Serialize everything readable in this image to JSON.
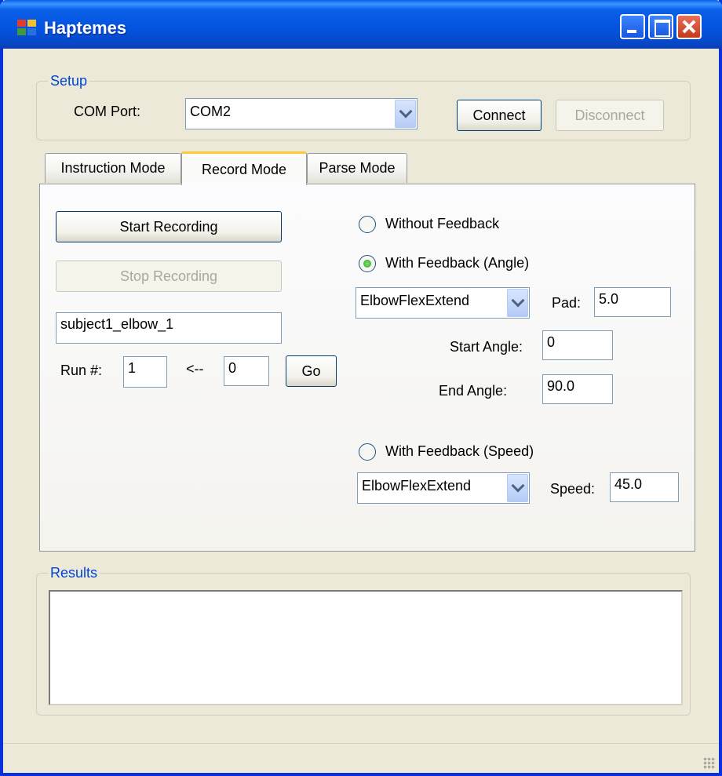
{
  "window": {
    "title": "Haptemes",
    "app_icon": "form-icon",
    "controls": {
      "minimize": "minimize-icon",
      "maximize": "maximize-icon",
      "close": "close-icon"
    }
  },
  "setup": {
    "legend": "Setup",
    "com_port_label": "COM Port:",
    "com_port_value": "COM2",
    "connect_label": "Connect",
    "disconnect_label": "Disconnect"
  },
  "tabs": [
    {
      "label": "Instruction Mode",
      "active": false
    },
    {
      "label": "Record Mode",
      "active": true
    },
    {
      "label": "Parse Mode",
      "active": false
    }
  ],
  "record": {
    "start_label": "Start Recording",
    "stop_label": "Stop Recording",
    "filename_value": "subject1_elbow_1",
    "run_label": "Run #:",
    "run_value": "1",
    "arrow_label": "<--",
    "goto_value": "0",
    "go_label": "Go"
  },
  "feedback": {
    "without_label": "Without Feedback",
    "angle_label": "With Feedback (Angle)",
    "angle_motion": "ElbowFlexExtend",
    "pad_label": "Pad:",
    "pad_value": "5.0",
    "start_angle_label": "Start Angle:",
    "start_angle_value": "0",
    "end_angle_label": "End Angle:",
    "end_angle_value": "90.0",
    "speed_mode_label": "With Feedback (Speed)",
    "speed_motion": "ElbowFlexExtend",
    "speed_label": "Speed:",
    "speed_value": "45.0",
    "selected": "angle"
  },
  "results": {
    "legend": "Results",
    "content": ""
  },
  "colors": {
    "titlebar": "#0a5fe8",
    "window_bg": "#ece9d8",
    "group_legend": "#0046d5",
    "active_tab_accent": "#ffc83c"
  }
}
